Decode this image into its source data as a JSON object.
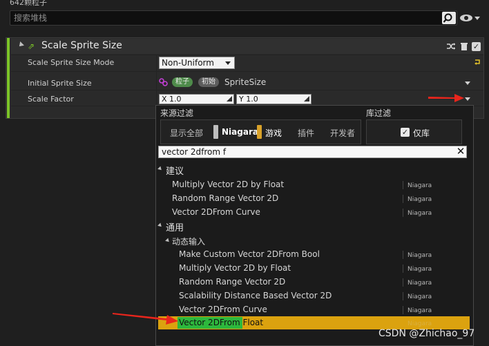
{
  "top": {
    "title": "642颗粒子",
    "search_placeholder": "搜索堆栈"
  },
  "module": {
    "title": "Scale Sprite Size",
    "rows": [
      {
        "label": "Scale Sprite Size Mode",
        "value": "Non-Uniform"
      },
      {
        "label": "Initial Sprite Size",
        "tag1": "粒子",
        "tag2": "初始",
        "value": "SpriteSize"
      },
      {
        "label": "Scale Factor",
        "x": "X  1.0",
        "y": "Y  1.0"
      }
    ]
  },
  "popup": {
    "source_filter_label": "来源过滤",
    "library_filter_label": "库过滤",
    "source_filters": [
      "显示全部",
      "Niagara",
      "游戏",
      "插件",
      "开发者"
    ],
    "library_only": "仅库",
    "filter_value": "vector 2dfrom f",
    "categories": {
      "suggested": "建议",
      "general": "通用",
      "dynamic_inputs": "动态输入"
    },
    "suggested_items": [
      {
        "name": "Multiply Vector 2D by Float",
        "source": "Niagara"
      },
      {
        "name": "Random Range Vector 2D",
        "source": "Niagara"
      },
      {
        "name": "Vector 2DFrom Curve",
        "source": "Niagara"
      }
    ],
    "dynamic_items": [
      {
        "name": "Make Custom Vector 2DFrom Bool",
        "source": "Niagara"
      },
      {
        "name": "Multiply Vector 2D by Float",
        "source": "Niagara"
      },
      {
        "name": "Random Range Vector 2D",
        "source": "Niagara"
      },
      {
        "name": "Scalability Distance Based Vector 2D",
        "source": "Niagara"
      },
      {
        "name": "Vector 2DFrom Curve",
        "source": "Niagara"
      },
      {
        "name": "Vector 2DFrom Float",
        "source": "Niagara"
      }
    ]
  },
  "watermark": "CSDN @Zhichao_97",
  "colors": {
    "accent_green": "#7cc428",
    "selection": "#dba20f",
    "match_highlight": "#2db83d",
    "arrow_red": "#e8251c"
  }
}
